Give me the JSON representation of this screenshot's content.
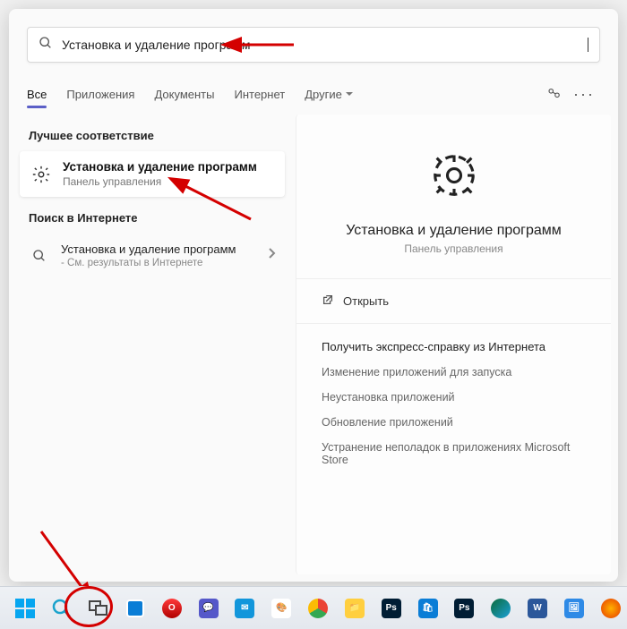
{
  "search": {
    "value": "Установка и удаление программ"
  },
  "tabs": {
    "all": "Все",
    "apps": "Приложения",
    "docs": "Документы",
    "internet": "Интернет",
    "other": "Другие"
  },
  "left": {
    "best_match_title": "Лучшее соответствие",
    "best_match_item": {
      "title": "Установка и удаление программ",
      "subtitle": "Панель управления"
    },
    "web_section_title": "Поиск в Интернете",
    "web_item": {
      "title": "Установка и удаление программ",
      "subtitle": "- См. результаты в Интернете"
    }
  },
  "preview": {
    "title": "Установка и удаление программ",
    "subtitle": "Панель управления",
    "open_label": "Открыть",
    "help_title": "Получить экспресс-справку из Интернета",
    "links": {
      "a": "Изменение приложений для запуска",
      "b": "Неустановка приложений",
      "c": "Обновление приложений",
      "d": "Устранение неполадок в приложениях Microsoft Store"
    }
  }
}
